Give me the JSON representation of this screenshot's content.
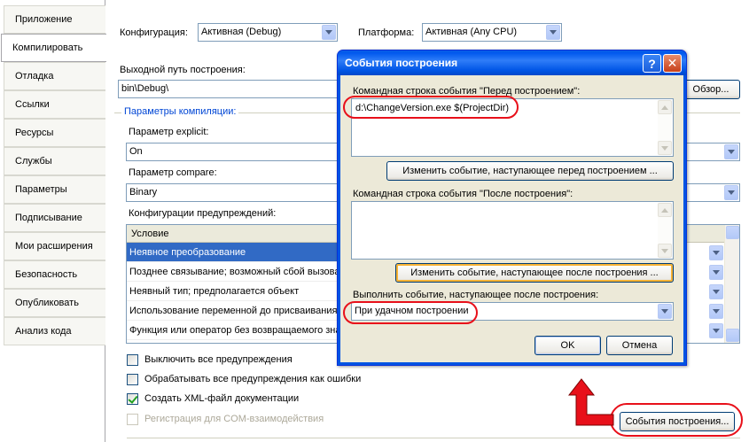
{
  "sidebar": {
    "items": [
      {
        "label": "Приложение"
      },
      {
        "label": "Компилировать"
      },
      {
        "label": "Отладка"
      },
      {
        "label": "Ссылки"
      },
      {
        "label": "Ресурсы"
      },
      {
        "label": "Службы"
      },
      {
        "label": "Параметры"
      },
      {
        "label": "Подписывание"
      },
      {
        "label": "Мои расширения"
      },
      {
        "label": "Безопасность"
      },
      {
        "label": "Опубликовать"
      },
      {
        "label": "Анализ кода"
      }
    ],
    "active_index": 1
  },
  "main": {
    "config_label": "Конфигурация:",
    "config_value": "Активная (Debug)",
    "platform_label": "Платформа:",
    "platform_value": "Активная (Any CPU)",
    "output_label": "Выходной путь построения:",
    "output_value": "bin\\Debug\\",
    "browse_label": "Обзор...",
    "compile_group_title": "Параметры компиляции:",
    "explicit_label": "Параметр explicit:",
    "explicit_value": "On",
    "compare_label": "Параметр compare:",
    "compare_value": "Binary",
    "warnings_label": "Конфигурации предупреждений:",
    "grid_header": "Условие",
    "grid_rows": [
      {
        "label": "Неявное преобразование",
        "selected": true
      },
      {
        "label": "Позднее связывание; возможный сбой вызова",
        "selected": false
      },
      {
        "label": "Неявный тип; предполагается объект",
        "selected": false
      },
      {
        "label": "Использование переменной до присваивания",
        "selected": false
      },
      {
        "label": "Функция или оператор без возвращаемого зна",
        "selected": false
      }
    ],
    "checkboxes": [
      {
        "label": "Выключить все предупреждения",
        "checked": false,
        "disabled": false
      },
      {
        "label": "Обрабатывать все предупреждения как ошибки",
        "checked": false,
        "disabled": false
      },
      {
        "label": "Создать XML-файл документации",
        "checked": true,
        "disabled": false
      },
      {
        "label": "Регистрация для COM-взаимодействия",
        "checked": false,
        "disabled": true
      }
    ],
    "build_events_button": "События построения..."
  },
  "dialog": {
    "title": "События построения",
    "help_glyph": "?",
    "close_glyph": "✕",
    "prebuild_label": "Командная строка события \"Перед построением\":",
    "prebuild_value": "d:\\ChangeVersion.exe $(ProjectDir)",
    "edit_prebuild_button": "Изменить событие, наступающее перед построением ...",
    "postbuild_label": "Командная строка события \"После построения\":",
    "postbuild_value": "",
    "edit_postbuild_button": "Изменить событие, наступающее после построения ...",
    "run_label": "Выполнить событие, наступающее после построения:",
    "run_value": "При удачном построении",
    "ok_button": "OK",
    "cancel_button": "Отмена"
  },
  "colors": {
    "accent_blue": "#316ac5",
    "title_blue": "#0054e3",
    "annotation_red": "#e8101a",
    "dialog_face": "#ece9d8"
  }
}
